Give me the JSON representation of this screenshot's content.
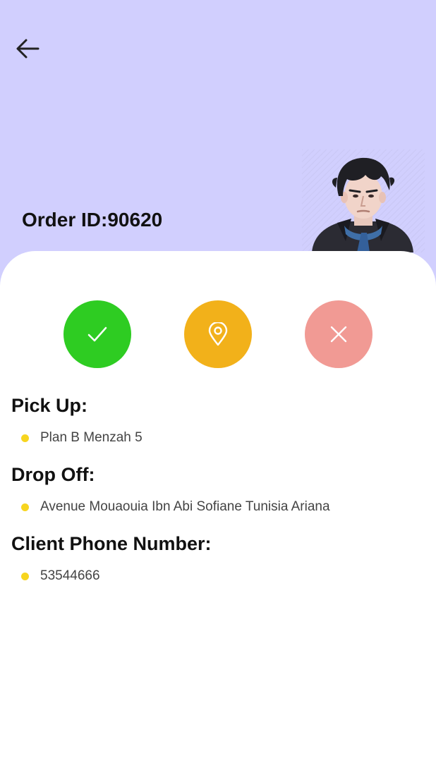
{
  "header": {
    "back_icon": "arrow-left-icon",
    "order_id": "Order ID:90620",
    "background_color": "#d1cffe"
  },
  "avatar": {
    "icon": "driver-avatar-illustration"
  },
  "actions": [
    {
      "name": "accept",
      "icon": "check-icon",
      "color": "#2ecc22"
    },
    {
      "name": "location",
      "icon": "map-pin-icon",
      "color": "#f2b11a"
    },
    {
      "name": "reject",
      "icon": "close-icon",
      "color": "#f19a94"
    }
  ],
  "details": {
    "pickup_title": "Pick Up:",
    "pickup_value": "Plan B Menzah 5",
    "dropoff_title": "Drop Off:",
    "dropoff_value": "Avenue Mouaouia Ibn Abi Sofiane Tunisia Ariana",
    "phone_title": "Client Phone Number:",
    "phone_value": "53544666",
    "bullet_color": "#f7d51f"
  }
}
